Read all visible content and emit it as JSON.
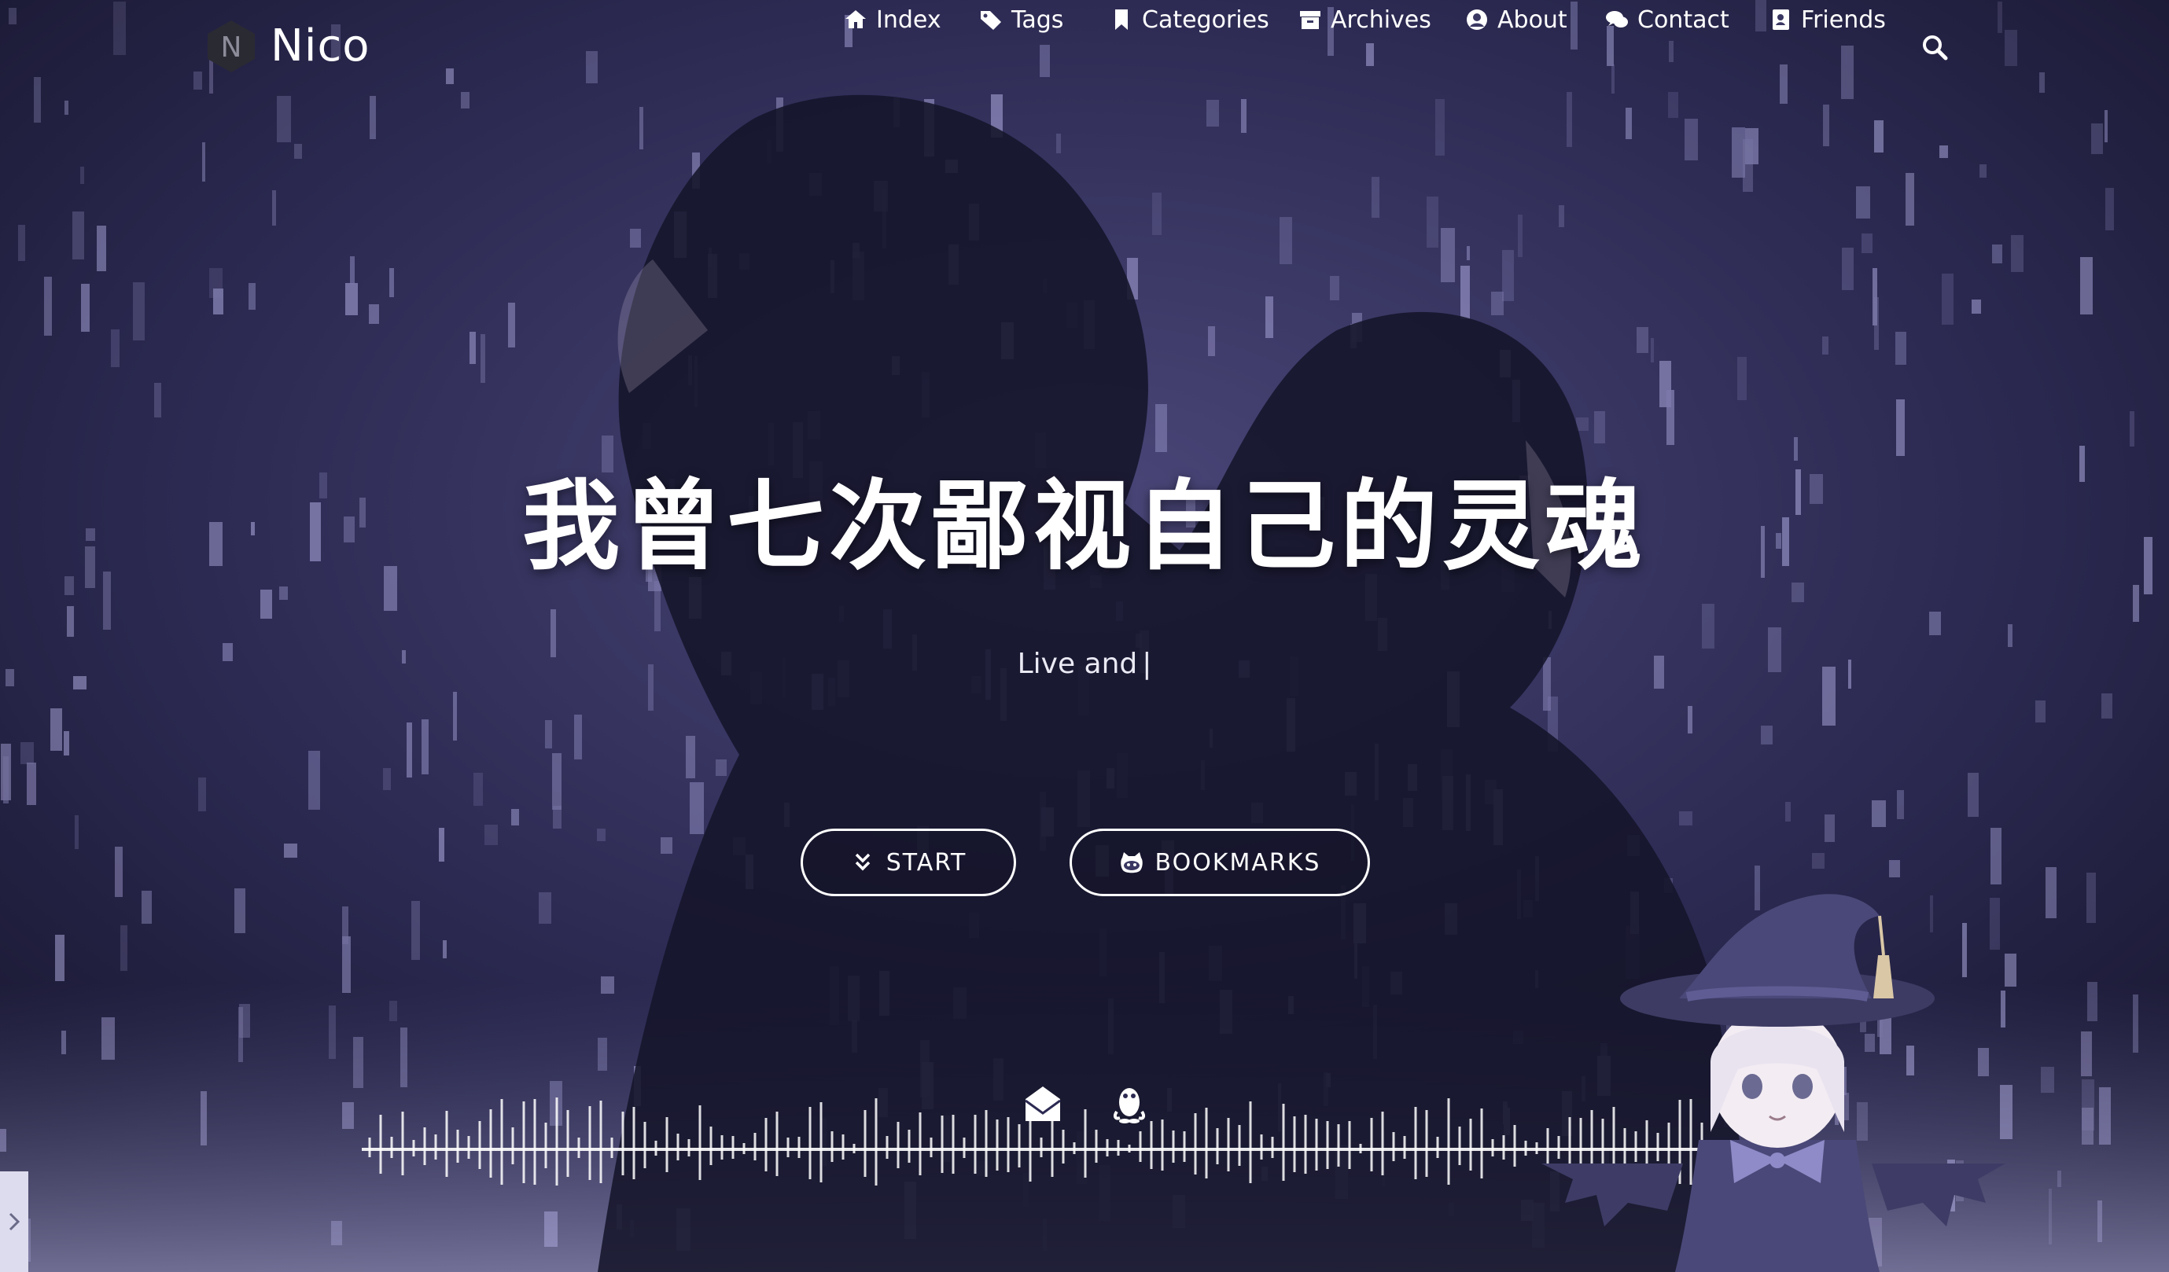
{
  "brand": {
    "logo_letter": "N",
    "name": "Nico"
  },
  "nav": [
    {
      "label": "Index",
      "icon": "home-icon"
    },
    {
      "label": "Tags",
      "icon": "tags-icon"
    },
    {
      "label": "Categories",
      "icon": "bookmark-icon"
    },
    {
      "label": "Archives",
      "icon": "archive-icon"
    },
    {
      "label": "About",
      "icon": "user-circle-icon"
    },
    {
      "label": "Contact",
      "icon": "comments-icon"
    },
    {
      "label": "Friends",
      "icon": "address-book-icon"
    }
  ],
  "search": {
    "icon": "search-icon"
  },
  "hero": {
    "title": "我曾七次鄙视自己的灵魂",
    "subtitle": "Live and",
    "cursor": "|"
  },
  "buttons": {
    "start": {
      "label": "START",
      "icon": "double-chevron-down-icon"
    },
    "bookmarks": {
      "label": "BOOKMARKS",
      "icon": "github-cat-icon"
    }
  },
  "social": [
    {
      "icon": "mail-icon"
    },
    {
      "icon": "qq-penguin-icon"
    }
  ],
  "side_toggle": {
    "icon": "chevron-right-icon"
  },
  "colors": {
    "background": "#1b1a33",
    "tint": "#8a86c8",
    "text": "#ffffff"
  }
}
